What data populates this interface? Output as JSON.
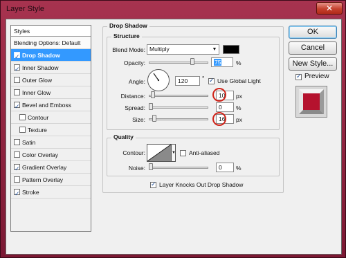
{
  "window": {
    "title": "Layer Style",
    "close_glyph": "✕"
  },
  "styles_panel": {
    "header": "Styles",
    "items": [
      {
        "label": "Blending Options: Default",
        "checkbox": false,
        "checked": false,
        "selected": false,
        "indent": false
      },
      {
        "label": "Drop Shadow",
        "checkbox": true,
        "checked": true,
        "selected": true,
        "indent": false
      },
      {
        "label": "Inner Shadow",
        "checkbox": true,
        "checked": true,
        "selected": false,
        "indent": false
      },
      {
        "label": "Outer Glow",
        "checkbox": true,
        "checked": false,
        "selected": false,
        "indent": false
      },
      {
        "label": "Inner Glow",
        "checkbox": true,
        "checked": false,
        "selected": false,
        "indent": false
      },
      {
        "label": "Bevel and Emboss",
        "checkbox": true,
        "checked": true,
        "selected": false,
        "indent": false
      },
      {
        "label": "Contour",
        "checkbox": true,
        "checked": false,
        "selected": false,
        "indent": true
      },
      {
        "label": "Texture",
        "checkbox": true,
        "checked": false,
        "selected": false,
        "indent": true
      },
      {
        "label": "Satin",
        "checkbox": true,
        "checked": false,
        "selected": false,
        "indent": false
      },
      {
        "label": "Color Overlay",
        "checkbox": true,
        "checked": false,
        "selected": false,
        "indent": false
      },
      {
        "label": "Gradient Overlay",
        "checkbox": true,
        "checked": true,
        "selected": false,
        "indent": false
      },
      {
        "label": "Pattern Overlay",
        "checkbox": true,
        "checked": false,
        "selected": false,
        "indent": false
      },
      {
        "label": "Stroke",
        "checkbox": true,
        "checked": true,
        "selected": false,
        "indent": false
      }
    ]
  },
  "drop_shadow": {
    "title": "Drop Shadow",
    "structure": {
      "title": "Structure",
      "blend_mode_label": "Blend Mode:",
      "blend_mode_value": "Multiply",
      "shadow_color": "#000000",
      "opacity_label": "Opacity:",
      "opacity_value": "75",
      "opacity_unit": "%",
      "angle_label": "Angle:",
      "angle_value": "120",
      "angle_unit": "°",
      "use_global_light_label": "Use Global Light",
      "distance_label": "Distance:",
      "distance_value": "10",
      "distance_unit": "px",
      "spread_label": "Spread:",
      "spread_value": "0",
      "spread_unit": "%",
      "size_label": "Size:",
      "size_value": "16",
      "size_unit": "px"
    },
    "quality": {
      "title": "Quality",
      "contour_label": "Contour:",
      "anti_aliased_label": "Anti-aliased",
      "noise_label": "Noise:",
      "noise_value": "0",
      "noise_unit": "%"
    },
    "knockout_label": "Layer Knocks Out Drop Shadow"
  },
  "buttons": {
    "ok": "OK",
    "cancel": "Cancel",
    "new_style": "New Style...",
    "preview": "Preview"
  },
  "colors": {
    "highlight_circle": "#d0241a",
    "selection": "#3399ff",
    "preview_fill": "#b5122e"
  }
}
